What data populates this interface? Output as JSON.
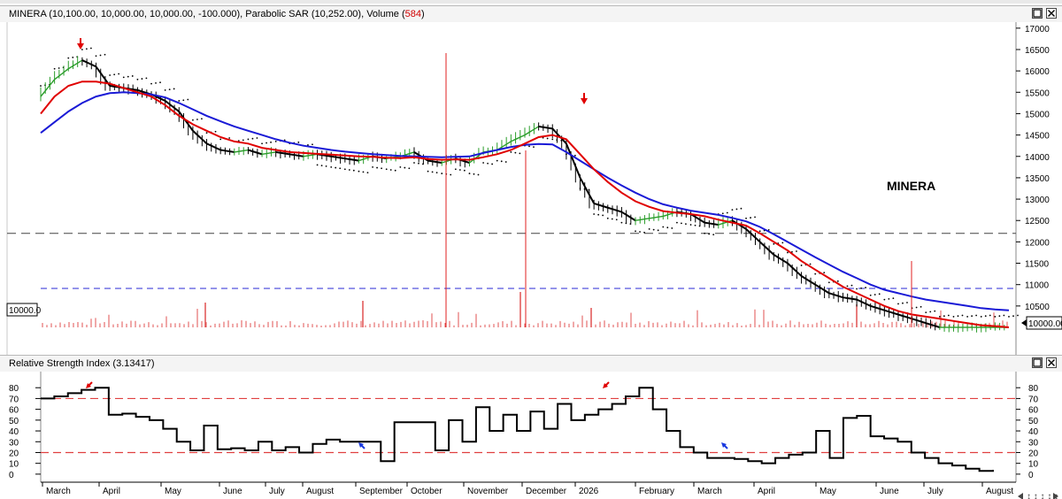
{
  "main_panel": {
    "title_prefix": "MINERA (10,100.00, 10,000.00, 10,000.00, -100.000), Parabolic SAR (10,252.00), Volume (",
    "title_volume": "584",
    "title_suffix": ")",
    "watermark_label": "MINERA",
    "left_value_label": "10000.0",
    "right_value_label": "10000.00",
    "restore_icon": "restore-icon",
    "close_icon": "close-icon"
  },
  "rsi_panel": {
    "title": "Relative Strength Index (3.13417)",
    "restore_icon": "restore-icon",
    "close_icon": "close-icon"
  },
  "colors": {
    "ma_short": "#e00000",
    "ma_long": "#1a1ad6",
    "up_bar": "#2a9d2a",
    "down_bar": "#000000",
    "volume": "#e05050",
    "sar": "#000000",
    "resistance_line": "#555555",
    "support_line": "#2a2ad6",
    "rsi_line": "#000000",
    "rsi_threshold": "#e04040",
    "arrow_top": "#e00000",
    "arrow_bottom": "#1a3adf"
  },
  "chart_data": [
    {
      "type": "line",
      "name": "MINERA price chart",
      "x_tick_labels": [
        "March",
        "April",
        "May",
        "June",
        "July",
        "August",
        "September",
        "October",
        "November",
        "December",
        "2026",
        "February",
        "March",
        "April",
        "May",
        "June",
        "July",
        "August"
      ],
      "y_ticks": [
        10500,
        11000,
        11500,
        12000,
        12500,
        13000,
        13500,
        14000,
        14500,
        15000,
        15500,
        16000,
        16500,
        17000
      ],
      "ylim": [
        10000,
        17100
      ],
      "x": [
        0,
        8,
        16,
        24,
        32,
        40,
        48,
        56,
        64,
        72,
        80,
        88,
        96,
        104,
        112,
        120,
        128,
        136,
        144,
        152,
        160,
        168,
        176,
        184,
        192,
        200,
        208,
        216,
        224,
        232,
        240,
        248,
        256,
        264,
        272,
        280,
        288,
        296,
        304,
        312,
        320,
        328,
        336,
        344,
        352,
        360,
        368,
        376,
        384,
        392,
        400,
        408,
        416,
        424,
        432,
        440,
        448,
        456,
        464,
        472,
        480,
        488,
        496,
        504,
        512,
        520,
        528,
        536,
        544,
        552,
        560
      ],
      "close": [
        15400,
        15800,
        16050,
        16250,
        16100,
        15650,
        15600,
        15550,
        15450,
        15300,
        15050,
        14600,
        14300,
        14150,
        14100,
        14150,
        14050,
        14100,
        14050,
        14000,
        14050,
        14000,
        13950,
        13900,
        14000,
        13950,
        14000,
        14100,
        13900,
        13850,
        13950,
        13850,
        14100,
        14150,
        14350,
        14500,
        14700,
        14650,
        14300,
        13500,
        12900,
        12800,
        12700,
        12500,
        12550,
        12600,
        12700,
        12650,
        12450,
        12400,
        12500,
        12300,
        12000,
        11700,
        11500,
        11200,
        11000,
        10800,
        10700,
        10650,
        10500,
        10400,
        10300,
        10200,
        10100,
        10000,
        10000,
        10000,
        10000,
        10000,
        10000
      ],
      "series": [
        {
          "name": "",
          "style": "ma_short",
          "values": [
            15000,
            15400,
            15650,
            15750,
            15750,
            15700,
            15600,
            15500,
            15400,
            15200,
            14950,
            14750,
            14600,
            14450,
            14350,
            14300,
            14200,
            14150,
            14100,
            14080,
            14060,
            14040,
            14020,
            14000,
            13990,
            13970,
            13960,
            13980,
            13940,
            13920,
            13930,
            13920,
            13980,
            14050,
            14150,
            14300,
            14450,
            14500,
            14400,
            14050,
            13700,
            13400,
            13150,
            12950,
            12820,
            12720,
            12680,
            12650,
            12600,
            12520,
            12450,
            12380,
            12200,
            12000,
            11800,
            11550,
            11350,
            11150,
            10950,
            10800,
            10650,
            10500,
            10380,
            10300,
            10250,
            10200,
            10150,
            10100,
            10050,
            10030,
            10000
          ]
        },
        {
          "name": "",
          "style": "ma_long",
          "values": [
            14550,
            14800,
            15050,
            15250,
            15400,
            15480,
            15500,
            15480,
            15450,
            15380,
            15250,
            15100,
            14950,
            14820,
            14700,
            14600,
            14500,
            14400,
            14320,
            14250,
            14200,
            14150,
            14110,
            14080,
            14050,
            14030,
            14010,
            14000,
            13990,
            13980,
            13990,
            14000,
            14080,
            14150,
            14220,
            14270,
            14290,
            14280,
            14100,
            13900,
            13700,
            13500,
            13320,
            13150,
            13000,
            12880,
            12800,
            12730,
            12680,
            12630,
            12560,
            12480,
            12350,
            12180,
            12000,
            11820,
            11640,
            11470,
            11300,
            11150,
            11000,
            10880,
            10800,
            10720,
            10650,
            10600,
            10550,
            10500,
            10450,
            10420,
            10400
          ]
        }
      ]
    },
    {
      "type": "line",
      "name": "Relative Strength Index",
      "y_ticks": [
        0,
        10,
        20,
        30,
        40,
        50,
        60,
        70,
        80
      ],
      "ylim": [
        -5,
        90
      ],
      "thresholds": [
        70,
        20
      ],
      "x": [
        0,
        10,
        20,
        30,
        40,
        50,
        60,
        70,
        80,
        90,
        100,
        110,
        120,
        130,
        140,
        150,
        160,
        170,
        180,
        190,
        200,
        210,
        220,
        230,
        240,
        250,
        260,
        270,
        280,
        290,
        300,
        310,
        320,
        330,
        340,
        350,
        360,
        370,
        380,
        390,
        400,
        410,
        420,
        430,
        440,
        450,
        460,
        470,
        480,
        490,
        500,
        510,
        520,
        530,
        540,
        550,
        560,
        570,
        580,
        590,
        600,
        610,
        620,
        630,
        640,
        650,
        660,
        670,
        680,
        690,
        700
      ],
      "values": [
        70,
        72,
        75,
        78,
        80,
        55,
        56,
        53,
        50,
        42,
        30,
        22,
        45,
        23,
        24,
        22,
        30,
        22,
        25,
        20,
        28,
        32,
        30,
        30,
        30,
        12,
        48,
        48,
        48,
        22,
        50,
        30,
        62,
        40,
        55,
        40,
        58,
        42,
        65,
        50,
        55,
        60,
        65,
        72,
        80,
        60,
        40,
        25,
        20,
        15,
        15,
        14,
        12,
        10,
        15,
        18,
        20,
        40,
        15,
        52,
        54,
        35,
        33,
        30,
        20,
        15,
        10,
        8,
        5,
        3,
        4
      ]
    }
  ],
  "annotations": {
    "rsi_markers": [
      "top",
      "top",
      "bottom",
      "bottom"
    ]
  }
}
